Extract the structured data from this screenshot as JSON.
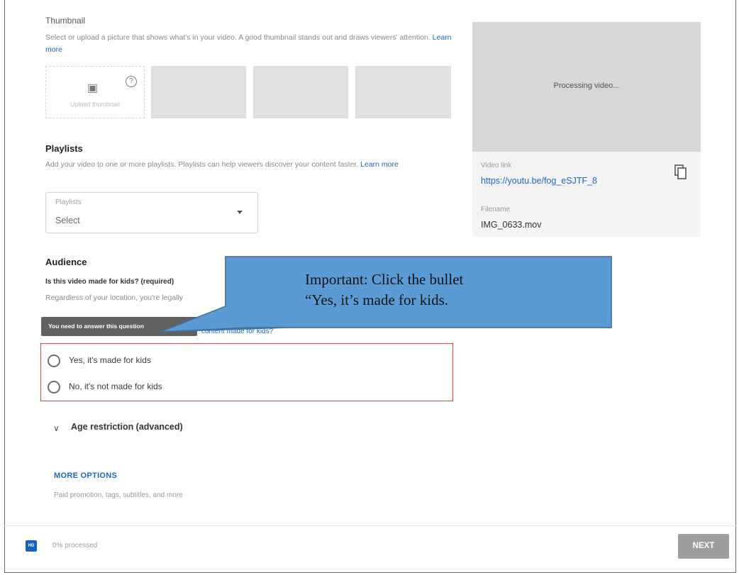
{
  "thumbnail": {
    "title": "Thumbnail",
    "description": "Select or upload a picture that shows what's in your video. A good thumbnail stands out and draws viewers' attention.",
    "learn_more": "Learn more",
    "upload_label": "Upload thumbnail"
  },
  "preview": {
    "processing_text": "Processing video...",
    "video_link_label": "Video link",
    "video_link": "https://youtu.be/fog_eSJTF_8",
    "filename_label": "Filename",
    "filename": "IMG_0633.mov"
  },
  "playlists": {
    "title": "Playlists",
    "description": "Add your video to one or more playlists. Playlists can help viewers discover your content faster.",
    "learn_more": "Learn more",
    "dropdown_label": "Playlists",
    "dropdown_value": "Select"
  },
  "audience": {
    "title": "Audience",
    "question": "Is this video made for kids? (required)",
    "body_start": "Regardless of your location, you're legally",
    "link_fragment": "content made for kids?",
    "tooltip": "You need to answer this question",
    "options": [
      "Yes, it's made for kids",
      "No, it's not made for kids"
    ]
  },
  "age_restriction": "Age restriction (advanced)",
  "more_options": {
    "label": "MORE OPTIONS",
    "description": "Paid promotion, tags, subtitles, and more"
  },
  "footer": {
    "hd_badge": "HD",
    "processed": "0% processed",
    "next": "NEXT"
  },
  "callout": {
    "line1": "Important: Click the bullet",
    "line2": "“Yes, it’s made for kids."
  },
  "colors": {
    "link": "#1a66c6",
    "error_border": "#d94343",
    "callout_fill": "#5b9bd5",
    "next_button": "#9e9e9e"
  }
}
